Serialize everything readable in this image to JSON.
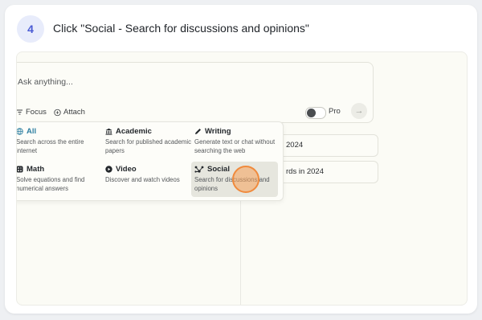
{
  "step": {
    "number": "4",
    "title": "Click \"Social - Search for discussions and opinions\""
  },
  "search": {
    "placeholder": "Ask anything...",
    "focus_label": "Focus",
    "attach_label": "Attach",
    "pro_label": "Pro",
    "pro_enabled": false
  },
  "background_cards": [
    {
      "text": "2024"
    },
    {
      "text": "rds in 2024"
    }
  ],
  "focus_options": [
    {
      "icon": "globe-icon",
      "title": "All",
      "description": "Search across the entire internet",
      "active": false
    },
    {
      "icon": "academic-icon",
      "title": "Academic",
      "description": "Search for published academic papers",
      "active": false
    },
    {
      "icon": "pencil-icon",
      "title": "Writing",
      "description": "Generate text or chat without searching the web",
      "active": false
    },
    {
      "icon": "math-icon",
      "title": "Math",
      "description": "Solve equations and find numerical answers",
      "active": false
    },
    {
      "icon": "play-icon",
      "title": "Video",
      "description": "Discover and watch videos",
      "active": false
    },
    {
      "icon": "social-icon",
      "title": "Social",
      "description": "Search for discussions and opinions",
      "active": true
    }
  ],
  "colors": {
    "accent": "#4a5bd4",
    "highlight": "#f08a3c",
    "all_option": "#2e7fa1"
  }
}
